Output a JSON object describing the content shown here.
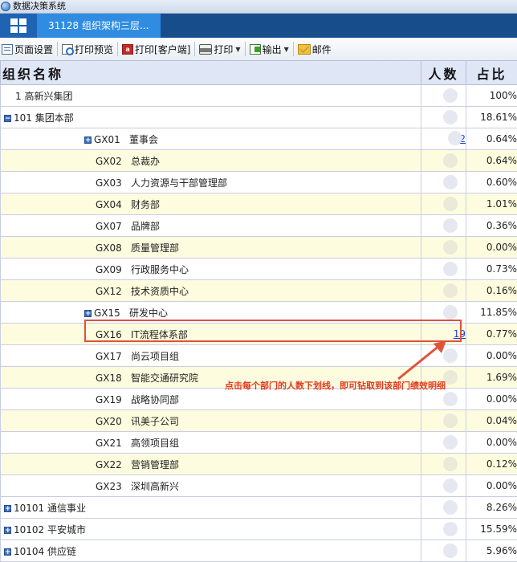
{
  "titlebar": {
    "title": "数据决策系统"
  },
  "tabs": [
    {
      "label": "31128 组织架构三层..."
    }
  ],
  "toolbar": {
    "page_setup": "页面设置",
    "print_preview": "打印预览",
    "print_client": "打印[客户端]",
    "print": "打印",
    "export": "输出",
    "mail": "邮件"
  },
  "table": {
    "headers": {
      "name": "组织名称",
      "count": "人数",
      "ratio": "占比"
    },
    "rows": [
      {
        "code": "1",
        "name": "高新兴集团",
        "count": "",
        "pct": "100%",
        "level": 0,
        "expander": ""
      },
      {
        "code": "101",
        "name": "集团本部",
        "count": "",
        "pct": "18.61%",
        "level": 0,
        "expander": "−"
      },
      {
        "code": "GX01",
        "name": "董事会",
        "count": "2",
        "pct": "0.64%",
        "level": 2,
        "expander": "+"
      },
      {
        "code": "GX02",
        "name": "总裁办",
        "count": "",
        "pct": "0.64%",
        "level": 2,
        "expander": ""
      },
      {
        "code": "GX03",
        "name": "人力资源与干部管理部",
        "count": "",
        "pct": "0.60%",
        "level": 2,
        "expander": ""
      },
      {
        "code": "GX04",
        "name": "财务部",
        "count": "",
        "pct": "1.01%",
        "level": 2,
        "expander": ""
      },
      {
        "code": "GX07",
        "name": "品牌部",
        "count": "",
        "pct": "0.36%",
        "level": 2,
        "expander": ""
      },
      {
        "code": "GX08",
        "name": "质量管理部",
        "count": "",
        "pct": "0.00%",
        "level": 2,
        "expander": ""
      },
      {
        "code": "GX09",
        "name": "行政服务中心",
        "count": "",
        "pct": "0.73%",
        "level": 2,
        "expander": ""
      },
      {
        "code": "GX12",
        "name": "技术资质中心",
        "count": "",
        "pct": "0.16%",
        "level": 2,
        "expander": ""
      },
      {
        "code": "GX15",
        "name": "研发中心",
        "count": "",
        "pct": "11.85%",
        "level": 2,
        "expander": "+"
      },
      {
        "code": "GX16",
        "name": "IT流程体系部",
        "count": "19",
        "pct": "0.77%",
        "level": 2,
        "expander": ""
      },
      {
        "code": "GX17",
        "name": "尚云项目组",
        "count": "",
        "pct": "0.00%",
        "level": 2,
        "expander": ""
      },
      {
        "code": "GX18",
        "name": "智能交通研究院",
        "count": "",
        "pct": "1.69%",
        "level": 2,
        "expander": ""
      },
      {
        "code": "GX19",
        "name": "战略协同部",
        "count": "",
        "pct": "0.00%",
        "level": 2,
        "expander": ""
      },
      {
        "code": "GX20",
        "name": "讯美子公司",
        "count": "",
        "pct": "0.04%",
        "level": 2,
        "expander": ""
      },
      {
        "code": "GX21",
        "name": "高领项目组",
        "count": "",
        "pct": "0.00%",
        "level": 2,
        "expander": ""
      },
      {
        "code": "GX22",
        "name": "营销管理部",
        "count": "",
        "pct": "0.12%",
        "level": 2,
        "expander": ""
      },
      {
        "code": "GX23",
        "name": "深圳高新兴",
        "count": "",
        "pct": "0.00%",
        "level": 2,
        "expander": ""
      },
      {
        "code": "10101",
        "name": "通信事业",
        "count": "",
        "pct": "8.26%",
        "level": 0,
        "expander": "+"
      },
      {
        "code": "10102",
        "name": "平安城市",
        "count": "",
        "pct": "15.59%",
        "level": 0,
        "expander": "+"
      },
      {
        "code": "10104",
        "name": "供应链",
        "count": "",
        "pct": "5.96%",
        "level": 0,
        "expander": "+"
      }
    ]
  },
  "annotation": {
    "text": "点击每个部门的人数下划线，即可钻取到该部门绩效明细"
  },
  "colors": {
    "accent_red": "#e0523a",
    "link_blue": "#1a3fc9",
    "row_alt": "#fefcdf",
    "header_bg": "#dfe6f6",
    "tab_bar": "#184d8c",
    "tab_active": "#2f8ce0"
  }
}
